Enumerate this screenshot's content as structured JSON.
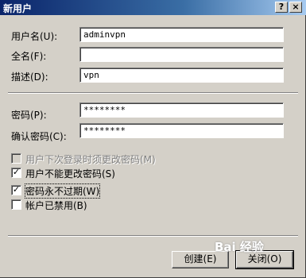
{
  "title": "新用户",
  "titlebar": {
    "help": "?",
    "close": "×"
  },
  "fields": {
    "username_label": "用户名(U):",
    "username_value": "adminvpn",
    "fullname_label": "全名(F):",
    "fullname_value": "",
    "description_label": "描述(D):",
    "description_value": "vpn",
    "password_label": "密码(P):",
    "password_value": "********",
    "confirm_label": "确认密码(C):",
    "confirm_value": "********"
  },
  "options": [
    {
      "label": "用户下次登录时须更改密码(M)",
      "checked": false,
      "disabled": true
    },
    {
      "label": "用户不能更改密码(S)",
      "checked": true,
      "disabled": false
    },
    {
      "label": "密码永不过期(W)",
      "checked": true,
      "disabled": false
    },
    {
      "label": "帐户已禁用(B)",
      "checked": false,
      "disabled": false
    }
  ],
  "buttons": {
    "create": "创建(E)",
    "close": "关闭(O)"
  },
  "watermark": "Bai 经验"
}
